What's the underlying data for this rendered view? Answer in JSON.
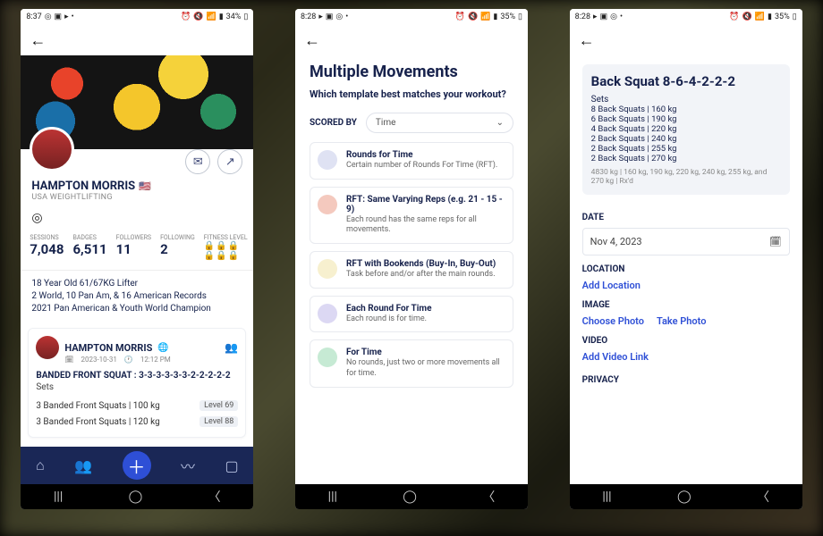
{
  "statusbar": {
    "s1": {
      "time": "8:37",
      "battery": "34%"
    },
    "s2": {
      "time": "8:28",
      "battery": "35%"
    },
    "s3": {
      "time": "8:28",
      "battery": "35%"
    }
  },
  "profile": {
    "name": "HAMPTON MORRIS",
    "flag": "🇺🇸",
    "org": "USA WEIGHTLIFTING",
    "stats": {
      "sessions": {
        "label": "SESSIONS",
        "value": "7,048"
      },
      "badges": {
        "label": "BADGES",
        "value": "6,511"
      },
      "followers": {
        "label": "FOLLOWERS",
        "value": "11"
      },
      "following": {
        "label": "FOLLOWING",
        "value": "2"
      },
      "fitness": {
        "label": "FITNESS LEVEL"
      }
    },
    "bio": [
      "18 Year Old 61/67KG Lifter",
      "2 World, 10 Pan Am, & 16 American Records",
      "2021 Pan American & Youth World Champion"
    ],
    "post": {
      "author": "HAMPTON MORRIS",
      "date": "2023-10-31",
      "time": "12:12 PM",
      "workout_title": "BANDED FRONT SQUAT : 3-3-3-3-3-3-2-2-2-2-2",
      "sets_label": "Sets",
      "rows": [
        {
          "text": "3 Banded Front Squats | 100 kg",
          "level": "Level 69"
        },
        {
          "text": "3 Banded Front Squats | 120 kg",
          "level": "Level 88"
        }
      ]
    }
  },
  "multi": {
    "title": "Multiple Movements",
    "subq": "Which template best matches your workout?",
    "scored_by_label": "SCORED BY",
    "scored_by_value": "Time",
    "options": [
      {
        "color": "#dfe2f3",
        "title": "Rounds for Time",
        "desc": "Certain number of Rounds For Time (RFT)."
      },
      {
        "color": "#f4c9be",
        "title": "RFT: Same Varying Reps (e.g. 21 - 15 - 9)",
        "desc": "Each round has the same reps for all movements."
      },
      {
        "color": "#f7f0cf",
        "title": "RFT with Bookends (Buy-In, Buy-Out)",
        "desc": "Task before and/or after the main rounds."
      },
      {
        "color": "#dcd8f3",
        "title": "Each Round For Time",
        "desc": "Each round is for time."
      },
      {
        "color": "#c6ead4",
        "title": "For Time",
        "desc": "No rounds, just two or more movements all for time."
      }
    ]
  },
  "log": {
    "title": "Back Squat 8-6-4-2-2-2",
    "sets_label": "Sets",
    "sets": [
      "8 Back Squats | 160 kg",
      "6 Back Squats | 190 kg",
      "4 Back Squats | 220 kg",
      "2 Back Squats | 240 kg",
      "2 Back Squats | 255 kg",
      "2 Back Squats | 270 kg"
    ],
    "notes": "4830 kg | 160 kg, 190 kg, 220 kg, 240 kg, 255 kg, and 270 kg | Rx'd",
    "date_label": "DATE",
    "date_value": "Nov 4, 2023",
    "location_label": "LOCATION",
    "add_location": "Add Location",
    "image_label": "IMAGE",
    "choose_photo": "Choose Photo",
    "take_photo": "Take Photo",
    "video_label": "VIDEO",
    "add_video": "Add Video Link",
    "privacy_label": "PRIVACY"
  }
}
